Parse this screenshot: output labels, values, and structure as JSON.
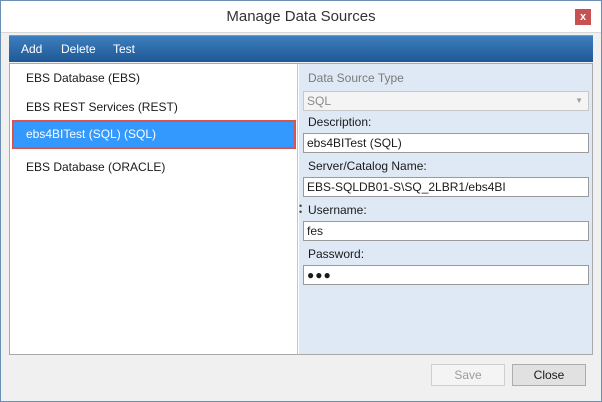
{
  "window": {
    "title": "Manage Data Sources",
    "close_glyph": "x"
  },
  "toolbar": {
    "add": "Add",
    "delete": "Delete",
    "test": "Test"
  },
  "list": {
    "items": [
      {
        "label": "EBS Database (EBS)"
      },
      {
        "label": "EBS REST Services (REST)"
      },
      {
        "label": "ebs4BITest (SQL) (SQL)"
      },
      {
        "label": "EBS Database (ORACLE)"
      }
    ],
    "selected_index": 2
  },
  "form": {
    "type_label": "Data Source Type",
    "type_value": "SQL",
    "description_label": "Description:",
    "description_value": "ebs4BITest (SQL)",
    "server_label": "Server/Catalog Name:",
    "server_value": "EBS-SQLDB01-S\\SQ_2LBR1/ebs4BI",
    "username_label": "Username:",
    "username_value": "fes",
    "password_label": "Password:",
    "password_value": "●●●"
  },
  "footer": {
    "save": "Save",
    "close": "Close"
  },
  "colors": {
    "toolbar": "#1f5896",
    "selection": "#3399ff",
    "selection_outline": "#d9534f",
    "form_background": "#dfe9f5"
  }
}
